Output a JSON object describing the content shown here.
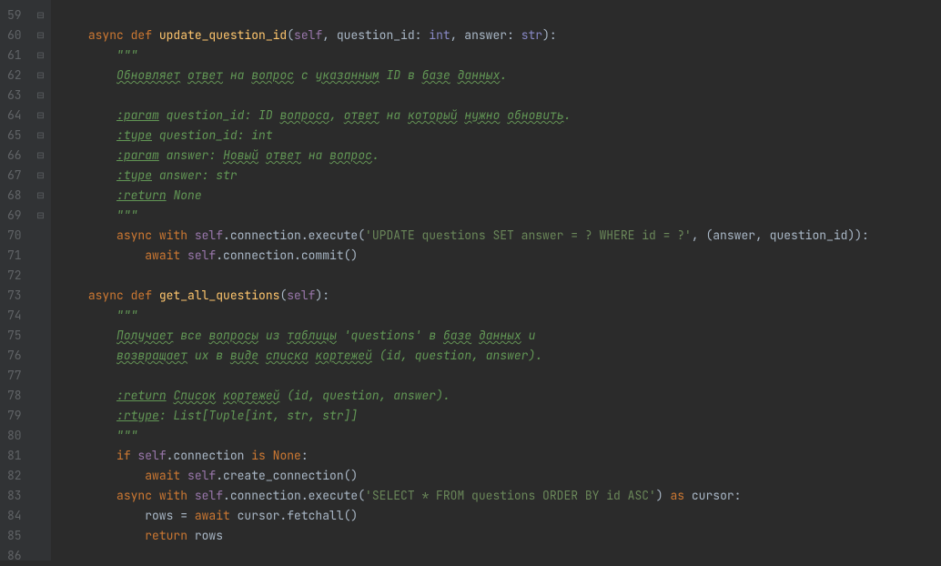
{
  "lines": [
    {
      "n": 59,
      "fold": "",
      "html": ""
    },
    {
      "n": 60,
      "fold": "⊟",
      "html": "    <span class='kw'>async def</span> <span class='def'>update_question_id</span>(<span class='self'>self</span>, question_id: <span class='builtin'>int</span>, answer: <span class='builtin'>str</span>):"
    },
    {
      "n": 61,
      "fold": "⊟",
      "html": "        <span class='doc'>\"\"\"</span>"
    },
    {
      "n": 62,
      "fold": "",
      "html": "        <span class='typo'>Обновляет</span> <span class='typo'>ответ</span> <span class='doc'>на</span> <span class='typo'>вопрос</span> <span class='doc'>с</span> <span class='typo'>указанным</span> <span class='doc'>ID в</span> <span class='typo'>базе</span> <span class='typo'>данных</span><span class='doc'>.</span>"
    },
    {
      "n": 63,
      "fold": "",
      "html": ""
    },
    {
      "n": 64,
      "fold": "",
      "html": "        <span class='tag'>:param</span> <span class='doc'>question_id: ID</span> <span class='typo'>вопроса</span><span class='doc'>,</span> <span class='typo'>ответ</span> <span class='doc'>на</span> <span class='typo'>который</span> <span class='typo'>нужно</span> <span class='typo'>обновить</span><span class='doc'>.</span>"
    },
    {
      "n": 65,
      "fold": "",
      "html": "        <span class='tag'>:type</span> <span class='doc'>question_id: int</span>"
    },
    {
      "n": 66,
      "fold": "",
      "html": "        <span class='tag'>:param</span> <span class='doc'>answer:</span> <span class='typo'>Новый</span> <span class='typo'>ответ</span> <span class='doc'>на</span> <span class='typo'>вопрос</span><span class='doc'>.</span>"
    },
    {
      "n": 67,
      "fold": "",
      "html": "        <span class='tag'>:type</span> <span class='doc'>answer: str</span>"
    },
    {
      "n": 68,
      "fold": "",
      "html": "        <span class='tag'>:return</span> <span class='doc'>None</span>"
    },
    {
      "n": 69,
      "fold": "⊟",
      "html": "        <span class='doc'>\"\"\"</span>"
    },
    {
      "n": 70,
      "fold": "⊟",
      "html": "        <span class='kw'>async with </span><span class='self'>self</span>.connection.execute(<span class='str'>'UPDATE questions SET answer = ? WHERE id = ?'</span>, (answer, question_id)):"
    },
    {
      "n": 71,
      "fold": "⊟",
      "html": "            <span class='kw'>await </span><span class='self'>self</span>.connection.commit()"
    },
    {
      "n": 72,
      "fold": "",
      "html": ""
    },
    {
      "n": 73,
      "fold": "⊟",
      "html": "    <span class='kw'>async def</span> <span class='def'>get_all_questions</span>(<span class='self'>self</span>):"
    },
    {
      "n": 74,
      "fold": "⊟",
      "html": "        <span class='doc'>\"\"\"</span>"
    },
    {
      "n": 75,
      "fold": "",
      "html": "        <span class='typo'>Получает</span> <span class='doc'>все</span> <span class='typo'>вопросы</span> <span class='doc'>из</span> <span class='typo'>таблицы</span> <span class='doc'>'questions' в</span> <span class='typo'>базе</span> <span class='typo'>данных</span> <span class='doc'>и</span>"
    },
    {
      "n": 76,
      "fold": "",
      "html": "        <span class='typo'>возвращает</span> <span class='doc'>их в</span> <span class='typo'>виде</span> <span class='typo'>списка</span> <span class='typo'>кортежей</span> <span class='doc'>(id, question, answer).</span>"
    },
    {
      "n": 77,
      "fold": "",
      "html": ""
    },
    {
      "n": 78,
      "fold": "",
      "html": "        <span class='tag'>:return</span> <span class='typo'>Список</span> <span class='typo'>кортежей</span> <span class='doc'>(id, question, answer).</span>"
    },
    {
      "n": 79,
      "fold": "",
      "html": "        <span class='tag'>:rtype</span><span class='doc'>: List[Tuple[int, str, str]]</span>"
    },
    {
      "n": 80,
      "fold": "⊟",
      "html": "        <span class='doc'>\"\"\"</span>"
    },
    {
      "n": 81,
      "fold": "⊟",
      "html": "        <span class='kw'>if </span><span class='self'>self</span>.connection <span class='kw'>is </span><span class='kw'>None</span>:"
    },
    {
      "n": 82,
      "fold": "",
      "html": "            <span class='kw'>await </span><span class='self'>self</span>.create_connection()"
    },
    {
      "n": 83,
      "fold": "⊟",
      "html": "        <span class='kw'>async with </span><span class='self'>self</span>.connection.execute(<span class='str'>'SELECT * FROM questions ORDER BY id ASC'</span>) <span class='kw'>as </span>cursor:"
    },
    {
      "n": 84,
      "fold": "",
      "html": "            rows = <span class='kw'>await </span>cursor.fetchall()"
    },
    {
      "n": 85,
      "fold": "⊟",
      "html": "            <span class='kw'>return </span>rows"
    },
    {
      "n": 86,
      "fold": "",
      "html": ""
    }
  ]
}
